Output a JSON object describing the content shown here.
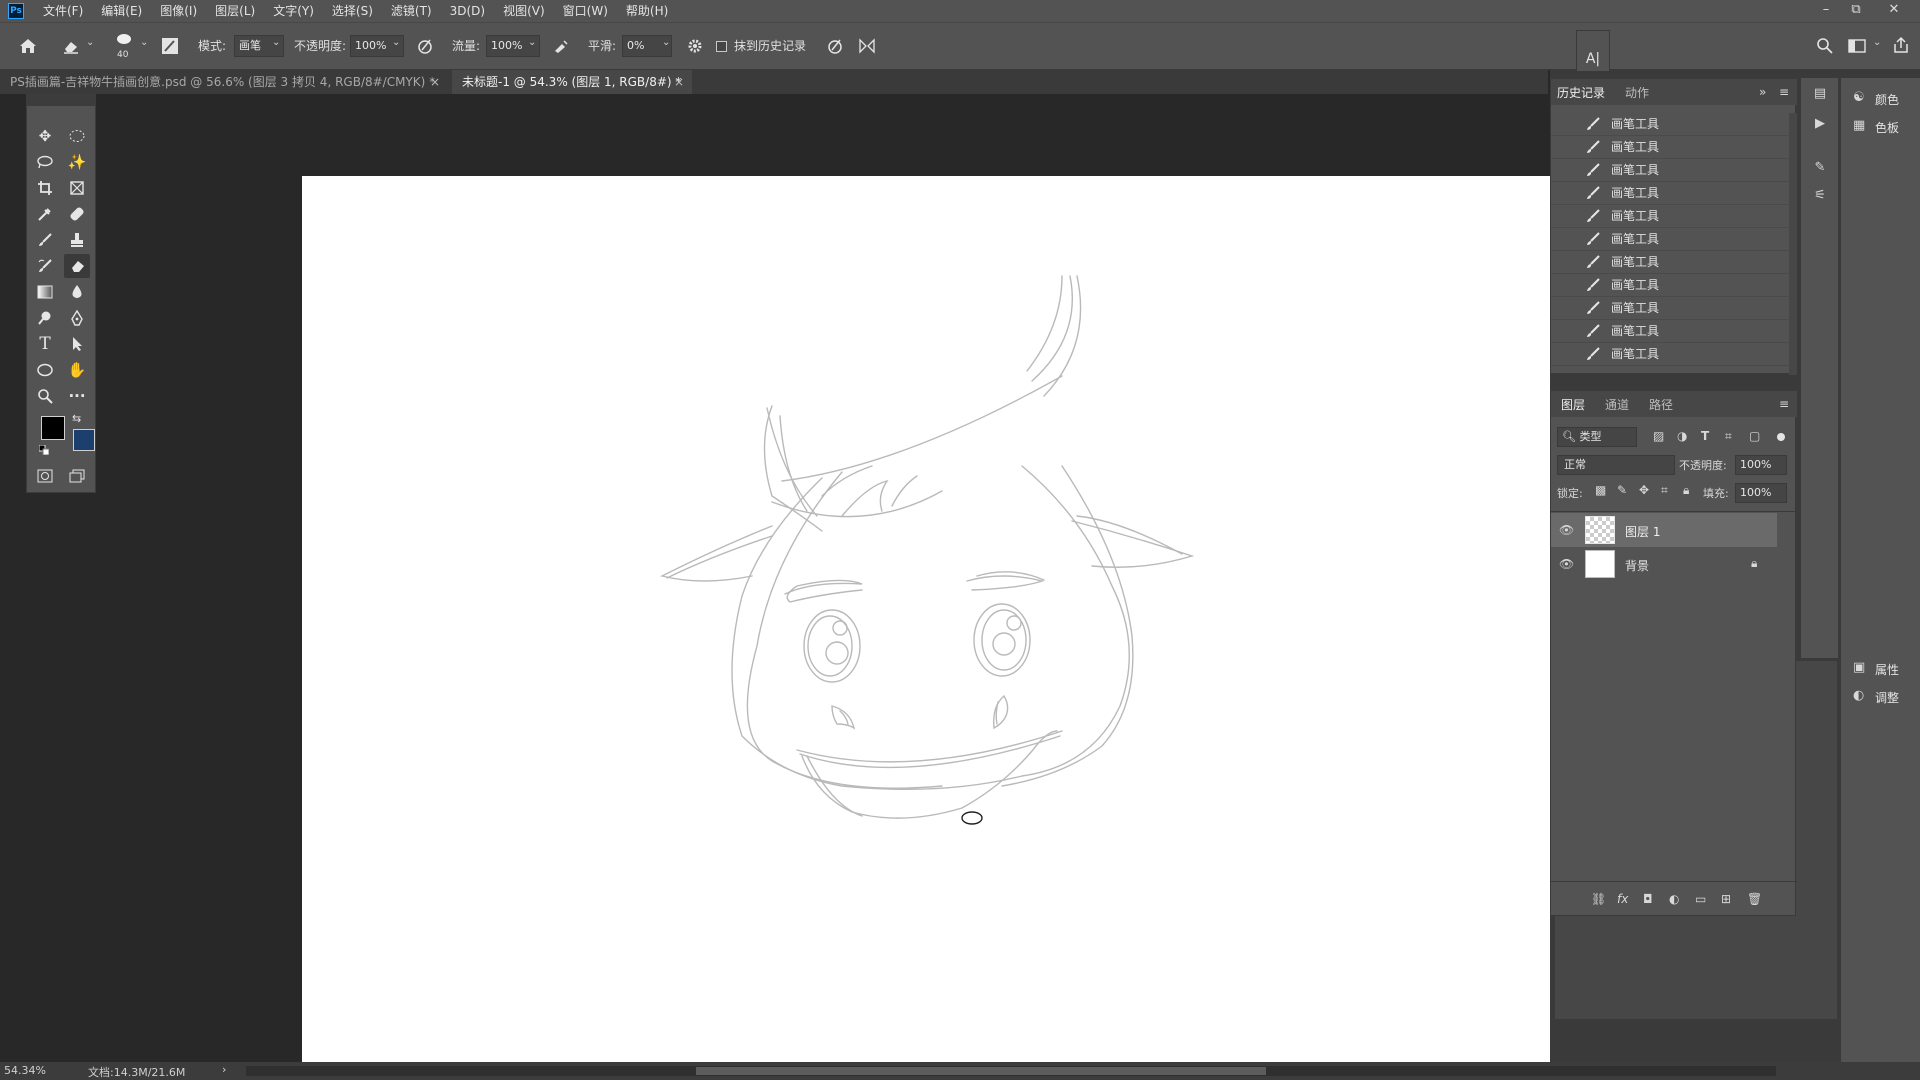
{
  "app": {
    "logo": "Ps"
  },
  "menu": [
    "文件(F)",
    "编辑(E)",
    "图像(I)",
    "图层(L)",
    "文字(Y)",
    "选择(S)",
    "滤镜(T)",
    "3D(D)",
    "视图(V)",
    "窗口(W)",
    "帮助(H)"
  ],
  "window_controls": {
    "minimize": "–",
    "restore": "⧉",
    "close": "✕"
  },
  "options": {
    "brush_size": "40",
    "mode_label": "模式:",
    "mode_value": "画笔",
    "opacity_label": "不透明度:",
    "opacity_value": "100%",
    "flow_label": "流量:",
    "flow_value": "100%",
    "smoothing_label": "平滑:",
    "smoothing_value": "0%",
    "erase_history_label": "抹到历史记录"
  },
  "tabs": [
    {
      "label": "PS插画篇-吉祥物牛插画创意.psd @ 56.6% (图层 3 拷贝 4, RGB/8#/CMYK) *",
      "close": "×",
      "active": false
    },
    {
      "label": "未标题-1 @ 54.3% (图层 1, RGB/8#) *",
      "close": "×",
      "active": true
    }
  ],
  "history_panel": {
    "tabs": [
      "历史记录",
      "动作"
    ],
    "items": [
      "画笔工具",
      "画笔工具",
      "画笔工具",
      "画笔工具",
      "画笔工具",
      "画笔工具",
      "画笔工具",
      "画笔工具",
      "画笔工具",
      "画笔工具",
      "画笔工具"
    ]
  },
  "right_dock": {
    "color_label": "颜色",
    "swatches_label": "色板",
    "properties_label": "属性",
    "adjustments_label": "调整"
  },
  "layers_panel": {
    "tabs": [
      "图层",
      "通道",
      "路径"
    ],
    "filter_kind": "类型",
    "blend_mode": "正常",
    "opacity_label": "不透明度:",
    "opacity_value": "100%",
    "lock_label": "锁定:",
    "fill_label": "填充:",
    "fill_value": "100%",
    "layers": [
      {
        "name": "图层 1",
        "selected": true,
        "thumb": "transparent"
      },
      {
        "name": "背景",
        "selected": false,
        "thumb": "white",
        "locked": true
      }
    ]
  },
  "status": {
    "zoom": "54.34%",
    "doc": "文档:14.3M/21.6M",
    "arrow": "›"
  },
  "colors": {
    "foreground": "#000000",
    "background": "#1d3f6e",
    "panel": "#535353",
    "workspace": "#282828"
  }
}
